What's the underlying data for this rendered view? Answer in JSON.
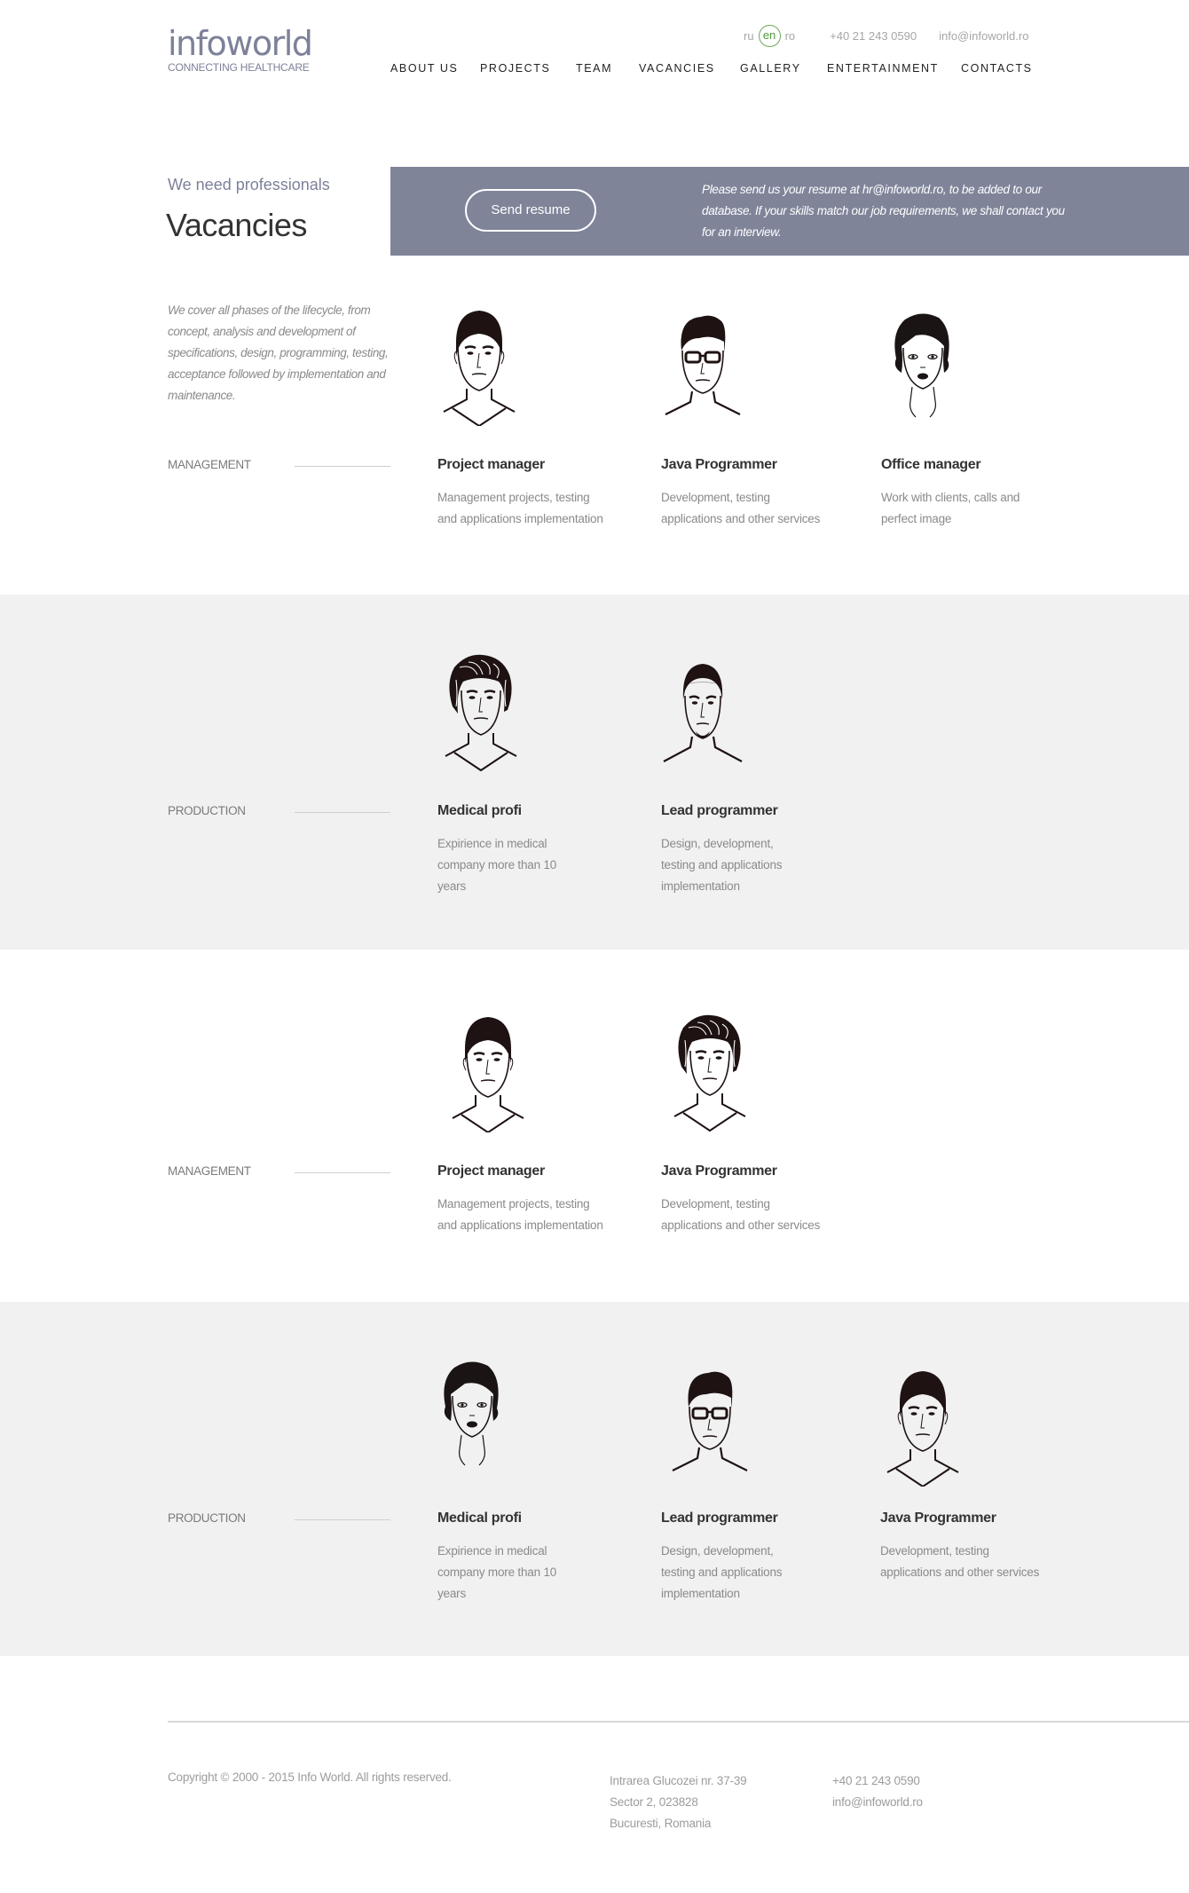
{
  "brand": {
    "name": "infoworld",
    "tagline": "CONNECTING HEALTHCARE",
    "color": "#7d8199"
  },
  "topbar": {
    "languages": [
      {
        "code": "ru",
        "active": false
      },
      {
        "code": "en",
        "active": true
      },
      {
        "code": "ro",
        "active": false
      }
    ],
    "phone": "+40 21 243 0590",
    "email": "info@infoworld.ro"
  },
  "nav": {
    "items": [
      {
        "label": "ABOUT US"
      },
      {
        "label": "PROJECTS"
      },
      {
        "label": "TEAM"
      },
      {
        "label": "VACANCIES"
      },
      {
        "label": "GALLERY"
      },
      {
        "label": "ENTERTAINMENT"
      },
      {
        "label": "CONTACTS"
      }
    ]
  },
  "hero": {
    "subtitle": "We need professionals",
    "title": "Vacancies",
    "send_resume_label": "Send resume",
    "banner_text": "Please send us your resume at hr@infoworld.ro, to be added to our database. If your skills match our job requirements, we shall contact you for an interview.",
    "banner_color": "#7f8499"
  },
  "intro": "We cover all phases of the lifecycle, from concept, analysis and development of specifications, design, programming, testing, acceptance followed by implementation and maintenance.",
  "sections": [
    {
      "category": "MANAGEMENT",
      "background": "white",
      "jobs": [
        {
          "title": "Project manager",
          "description": "Management projects, testing and applications implementation",
          "portrait": "man-short-hair"
        },
        {
          "title": "Java Programmer",
          "description": "Development, testing applications and other services",
          "portrait": "man-glasses"
        },
        {
          "title": "Office manager",
          "description": "Work with clients, calls and perfect image",
          "portrait": "woman-short-hair"
        }
      ]
    },
    {
      "category": "PRODUCTION",
      "background": "gray",
      "jobs": [
        {
          "title": "Medical profi",
          "description": "Expirience in medical company more than 10 years",
          "portrait": "man-long-hair"
        },
        {
          "title": "Lead programmer",
          "description": "Design, development, testing and applications implementation",
          "portrait": "man-goatee"
        }
      ]
    },
    {
      "category": "MANAGEMENT",
      "background": "white",
      "jobs": [
        {
          "title": "Project manager",
          "description": "Management projects, testing and applications implementation",
          "portrait": "man-short-hair"
        },
        {
          "title": "Java Programmer",
          "description": "Development, testing applications and other services",
          "portrait": "man-long-hair"
        }
      ]
    },
    {
      "category": "PRODUCTION",
      "background": "gray",
      "jobs": [
        {
          "title": "Medical profi",
          "description": "Expirience in medical company more than 10 years",
          "portrait": "woman-short-hair"
        },
        {
          "title": "Lead programmer",
          "description": "Design, development, testing and applications implementation",
          "portrait": "man-glasses"
        },
        {
          "title": "Java Programmer",
          "description": "Development, testing applications and other services",
          "portrait": "man-short-hair"
        }
      ]
    }
  ],
  "footer": {
    "copyright": "Copyright © 2000 - 2015 Info World. All rights reserved.",
    "address": [
      "Intrarea Glucozei nr. 37-39",
      "Sector 2, 023828",
      "Bucuresti, Romania"
    ],
    "phone": "+40 21 243 0590",
    "email": "info@infoworld.ro"
  }
}
